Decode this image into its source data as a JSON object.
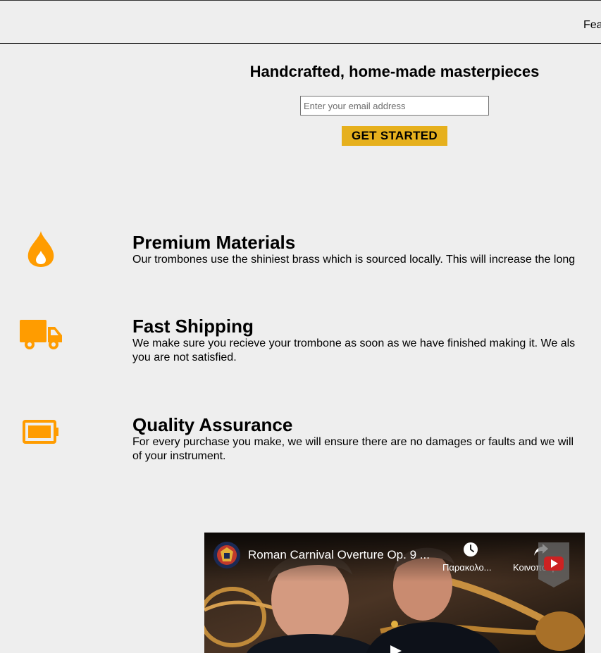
{
  "header": {
    "nav_link": "Fea"
  },
  "hero": {
    "title": "Handcrafted, home-made masterpieces",
    "email_placeholder": "Enter your email address",
    "cta_label": "GET STARTED"
  },
  "features": [
    {
      "icon": "fire-icon",
      "title": "Premium Materials",
      "description": "Our trombones use the shiniest brass which is sourced locally. This will increase the long"
    },
    {
      "icon": "truck-icon",
      "title": "Fast Shipping",
      "description_line1": "We make sure you recieve your trombone as soon as we have finished making it. We als",
      "description_line2": "you are not satisfied."
    },
    {
      "icon": "battery-icon",
      "title": "Quality Assurance",
      "description_line1": "For every purchase you make, we will ensure there are no damages or faults and we will",
      "description_line2": "of your instrument."
    }
  ],
  "video": {
    "title": "Roman Carnival Overture Op. 9 ...",
    "watch_later_label": "Παρακολο...",
    "share_label": "Κοινοποιή..."
  },
  "colors": {
    "accent": "#ff9c00",
    "cta": "#e6b01d",
    "background": "#eeeeee"
  }
}
